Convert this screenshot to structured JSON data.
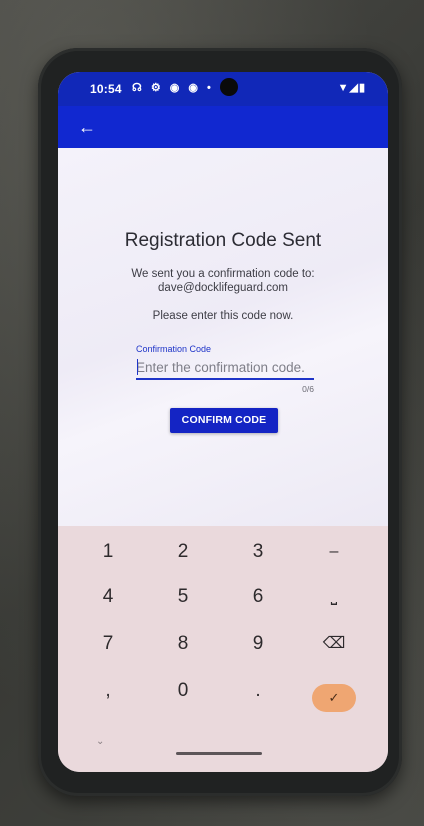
{
  "status_bar": {
    "time": "10:54",
    "left_icons": "☊ ⚙ ◉ ◉ •",
    "right_icons": "▼◢▮"
  },
  "app_bar": {
    "back_icon": "←"
  },
  "main": {
    "title": "Registration Code Sent",
    "sent_message": "We sent you a confirmation code to:",
    "email": "dave@docklifeguard.com",
    "instruction": "Please enter this code now.",
    "field": {
      "label": "Confirmation Code",
      "placeholder": "Enter the confirmation code.",
      "value": "",
      "counter": "0/6"
    },
    "confirm_button": "CONFIRM CODE"
  },
  "keyboard": {
    "keys": [
      {
        "label": "1",
        "name": "key-1"
      },
      {
        "label": "2",
        "name": "key-2"
      },
      {
        "label": "3",
        "name": "key-3"
      },
      {
        "label": "–",
        "name": "key-minus"
      },
      {
        "label": "4",
        "name": "key-4"
      },
      {
        "label": "5",
        "name": "key-5"
      },
      {
        "label": "6",
        "name": "key-6"
      },
      {
        "label": "⎵",
        "name": "key-space"
      },
      {
        "label": "7",
        "name": "key-7"
      },
      {
        "label": "8",
        "name": "key-8"
      },
      {
        "label": "9",
        "name": "key-9"
      },
      {
        "label": "⌫",
        "name": "key-backspace"
      },
      {
        "label": ",",
        "name": "key-comma"
      },
      {
        "label": "0",
        "name": "key-0"
      },
      {
        "label": ".",
        "name": "key-period"
      }
    ],
    "enter_key": "✓",
    "collapse_icon": "⌄"
  },
  "colors": {
    "status_bar": "#1128b8",
    "app_bar": "#1128d0",
    "accent": "#1e34c8",
    "button": "#1424c4",
    "keyboard_bg": "#ead9dc",
    "enter_key": "#efa672"
  }
}
